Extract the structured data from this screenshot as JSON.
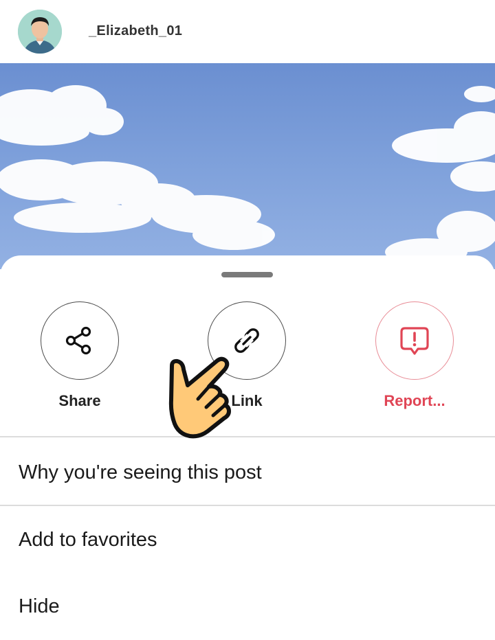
{
  "post": {
    "username": "_Elizabeth_01",
    "avatar_icon": "user-avatar"
  },
  "sheet": {
    "actions": [
      {
        "label": "Share",
        "icon": "share-icon"
      },
      {
        "label": "Link",
        "icon": "link-icon"
      },
      {
        "label": "Report...",
        "icon": "report-icon",
        "color": "#e04555"
      }
    ],
    "menu": [
      "Why you're seeing this post",
      "Add to favorites",
      "Hide"
    ]
  },
  "colors": {
    "report": "#e04555",
    "sky": "#7fa1db",
    "hand_fill": "#ffc978"
  }
}
